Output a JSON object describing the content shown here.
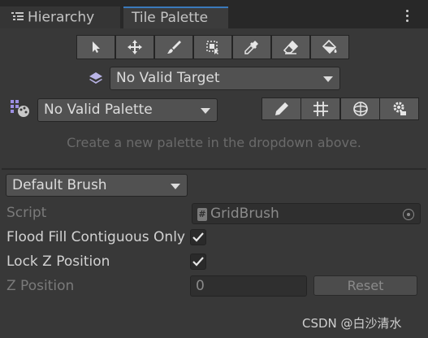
{
  "tabs": [
    {
      "label": "Hierarchy",
      "icon": "list-icon"
    },
    {
      "label": "Tile Palette",
      "active": true
    }
  ],
  "toolbar": {
    "tools": [
      {
        "name": "select-tool",
        "icon": "arrow-icon"
      },
      {
        "name": "move-tool",
        "icon": "move-icon"
      },
      {
        "name": "paint-tool",
        "icon": "brush-icon"
      },
      {
        "name": "box-fill-tool",
        "icon": "box-fill-icon"
      },
      {
        "name": "pick-tool",
        "icon": "eyedropper-icon"
      },
      {
        "name": "erase-tool",
        "icon": "eraser-icon"
      },
      {
        "name": "flood-fill-tool",
        "icon": "bucket-icon"
      }
    ]
  },
  "target": {
    "label": "No Valid Target"
  },
  "palette": {
    "label": "No Valid Palette",
    "edit_tools": [
      "pencil-icon",
      "grid-icon",
      "gizmo-icon",
      "settings-icon"
    ]
  },
  "hint": "Create a new palette in the dropdown above.",
  "brush": {
    "selected": "Default Brush",
    "script_label": "Script",
    "script_value": "GridBrush",
    "flood_fill_label": "Flood Fill Contiguous Only",
    "flood_fill_checked": true,
    "lock_z_label": "Lock Z Position",
    "lock_z_checked": true,
    "z_position_label": "Z Position",
    "z_position_value": "0",
    "reset_label": "Reset"
  },
  "watermark": "CSDN @白沙清水",
  "colors": {
    "accent": "#3a79bb",
    "background": "#383838"
  }
}
